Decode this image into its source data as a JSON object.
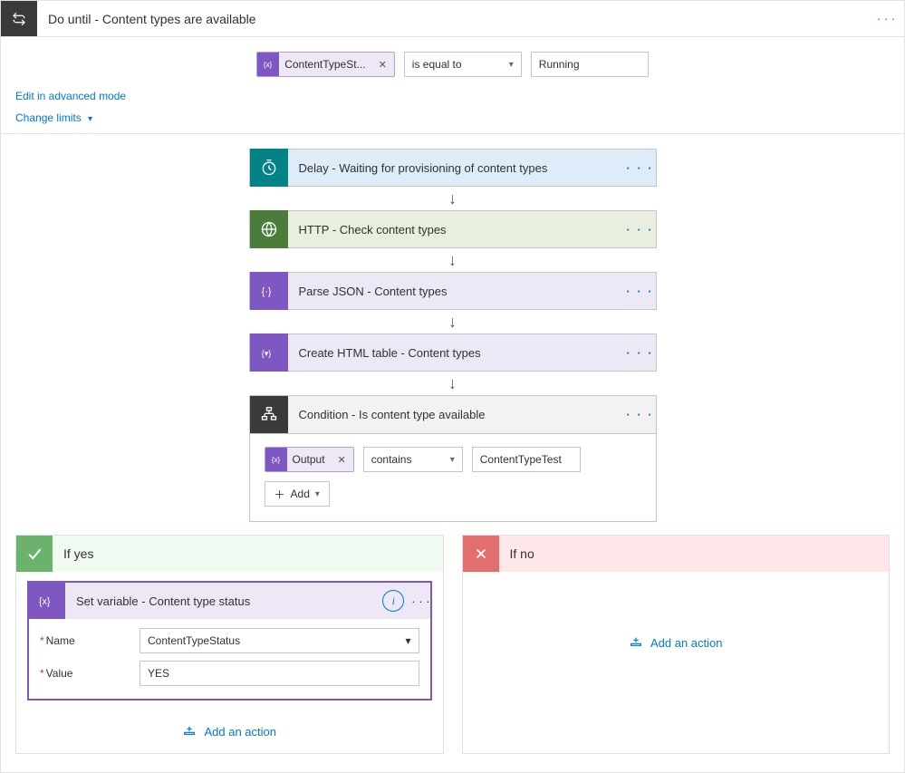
{
  "header": {
    "title": "Do until - Content types are available"
  },
  "top_condition": {
    "token": "ContentTypeSt...",
    "operator": "is equal to",
    "value": "Running"
  },
  "links": {
    "advanced": "Edit in advanced mode",
    "limits": "Change limits"
  },
  "steps": {
    "delay": "Delay - Waiting for provisioning of content types",
    "http": "HTTP - Check content types",
    "parse": "Parse JSON - Content types",
    "table": "Create HTML table - Content types",
    "condition": "Condition - Is content type available"
  },
  "inner_condition": {
    "token": "Output",
    "operator": "contains",
    "value": "ContentTypeTest",
    "add_label": "Add"
  },
  "branches": {
    "yes_label": "If yes",
    "no_label": "If no",
    "add_action": "Add an action"
  },
  "set_var": {
    "title": "Set variable - Content type status",
    "name_label": "Name",
    "name_value": "ContentTypeStatus",
    "value_label": "Value",
    "value_value": "YES"
  }
}
